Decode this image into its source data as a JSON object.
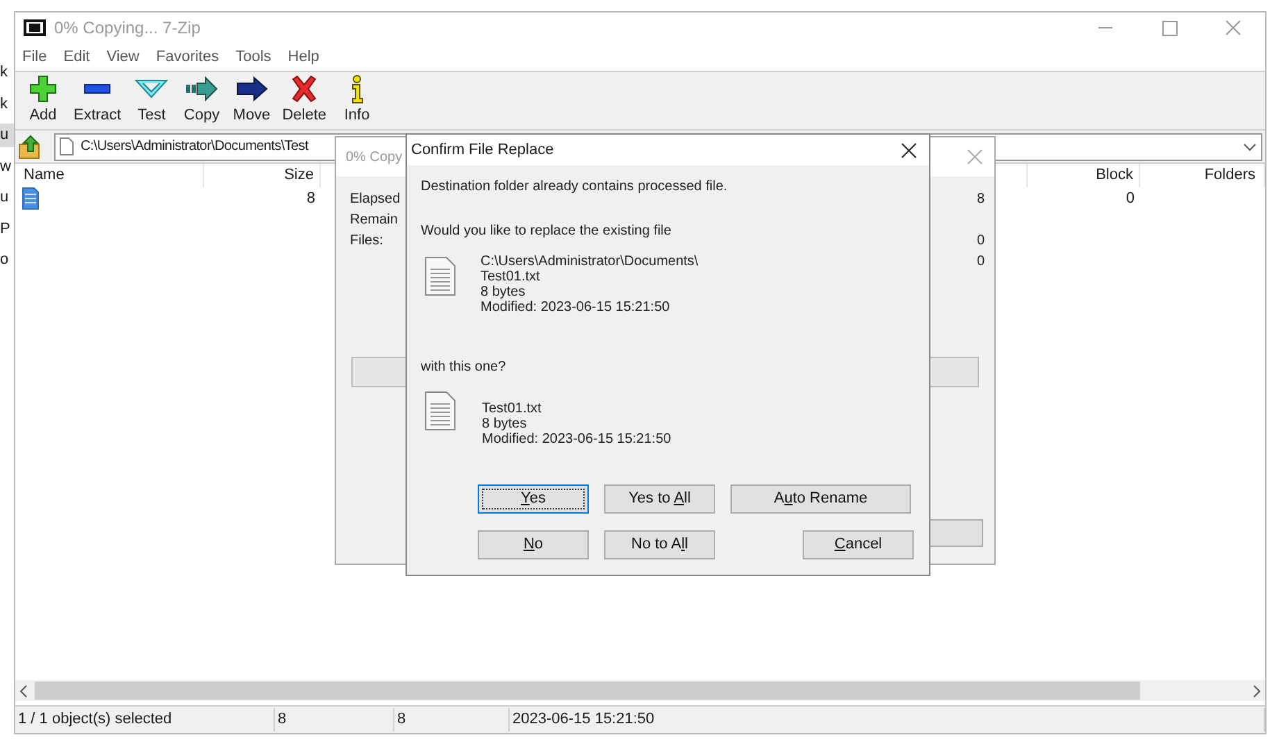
{
  "desktop_behind": {
    "items": [
      {
        "label": "k",
        "selected": false
      },
      {
        "label": "k",
        "selected": false
      },
      {
        "label": "u",
        "selected": true
      },
      {
        "label": "w",
        "selected": false
      },
      {
        "label": "u",
        "selected": false
      },
      {
        "label": "P",
        "selected": false
      },
      {
        "label": "o",
        "selected": false
      }
    ]
  },
  "window": {
    "title": "0% Copying... 7-Zip"
  },
  "menu": [
    "File",
    "Edit",
    "View",
    "Favorites",
    "Tools",
    "Help"
  ],
  "toolbar": [
    {
      "label": "Add",
      "kind": "add"
    },
    {
      "label": "Extract",
      "kind": "extract"
    },
    {
      "label": "Test",
      "kind": "test"
    },
    {
      "label": "Copy",
      "kind": "copy"
    },
    {
      "label": "Move",
      "kind": "move"
    },
    {
      "label": "Delete",
      "kind": "delete"
    },
    {
      "label": "Info",
      "kind": "info"
    }
  ],
  "address": {
    "value": "C:\\Users\\Administrator\\Documents\\Test"
  },
  "file_list": {
    "columns": [
      "Name",
      "Size",
      "Block",
      "Folders"
    ],
    "rows": [
      {
        "size": "8",
        "block": "0",
        "selected": false
      }
    ]
  },
  "status_bar": [
    "1 / 1 object(s) selected",
    "8",
    "8",
    "2023-06-15 15:21:50"
  ],
  "progress_dialog": {
    "title": "0% Copy",
    "rows": [
      {
        "label": "Elapsed",
        "value": "8"
      },
      {
        "label": "Remain"
      },
      {
        "label": "Files:",
        "value": "0"
      },
      {
        "value": "0"
      }
    ],
    "level": 0
  },
  "confirm_dialog": {
    "title": "Confirm File Replace",
    "message": "Destination folder already contains processed file.",
    "question": "Would you like to replace the existing file",
    "existing_file": [
      "C:\\Users\\Administrator\\Documents\\",
      "Test01.txt",
      "8 bytes",
      "Modified: 2023-06-15 15:21:50"
    ],
    "with_label": "with this one?",
    "new_file": [
      "Test01.txt",
      "8 bytes",
      "Modified: 2023-06-15 15:21:50"
    ],
    "button_rows": [
      [
        {
          "key": "Y",
          "after": "es",
          "focused": true,
          "kind": "normal"
        },
        {
          "before": "Yes to ",
          "key": "A",
          "after": "ll",
          "focused": false,
          "kind": "normal"
        },
        {
          "before": "A",
          "key": "u",
          "after": "to Rename",
          "focused": false,
          "kind": "wide"
        }
      ],
      [
        {
          "key": "N",
          "after": "o",
          "focused": false,
          "kind": "normal"
        },
        {
          "before": "No to A",
          "key": "l",
          "after": "l",
          "focused": false,
          "kind": "normal"
        },
        {
          "kind": "spacer"
        },
        {
          "key": "C",
          "after": "ancel",
          "focused": false,
          "kind": "normal"
        }
      ]
    ]
  }
}
